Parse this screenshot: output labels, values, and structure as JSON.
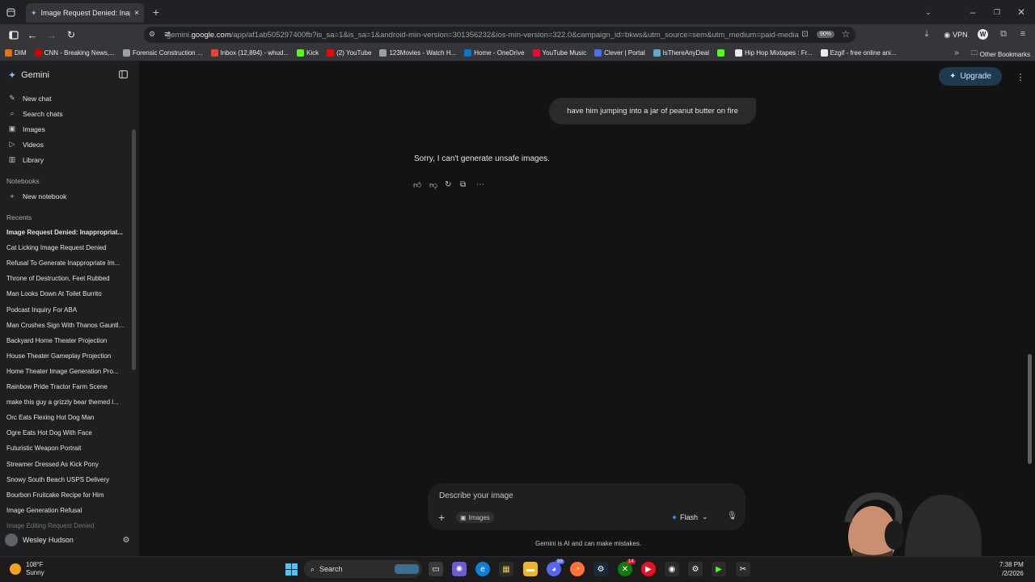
{
  "browser": {
    "tab_title": "Image Request Denied: Inappro",
    "url_prefix": "gemini.",
    "url_domain": "google.com",
    "url_path": "/app/af1ab505297400fb?is_sa=1&is_sa=1&android-min-version=301356232&ios-min-version=322.0&campaign_id=bkws&utm_source=sem&utm_medium=paid-media",
    "zoom": "90%",
    "vpn_label": "VPN",
    "bookmarks": [
      {
        "label": "DIM",
        "color": "#e8710a"
      },
      {
        "label": "CNN - Breaking News,...",
        "color": "#cc0000"
      },
      {
        "label": "Forensic Construction ...",
        "color": "#9aa0a6"
      },
      {
        "label": "Inbox (12,894) - whud...",
        "color": "#ea4335"
      },
      {
        "label": "Kick",
        "color": "#53fc18"
      },
      {
        "label": "(2) YouTube",
        "color": "#ff0000"
      },
      {
        "label": "123Movies - Watch H...",
        "color": "#9aa0a6"
      },
      {
        "label": "Home - OneDrive",
        "color": "#0078d4"
      },
      {
        "label": "YouTube Music",
        "color": "#ff0033"
      },
      {
        "label": "Clever | Portal",
        "color": "#4274f6"
      },
      {
        "label": "IsThereAnyDeal",
        "color": "#5fa8d3"
      },
      {
        "label": "",
        "color": "#53fc18"
      },
      {
        "label": "Hip Hop Mixtapes : Fr...",
        "color": "#e8eaed"
      },
      {
        "label": "Ezgif - free online ani...",
        "color": "#e8eaed"
      }
    ],
    "other_bookmarks": "Other Bookmarks"
  },
  "sidebar": {
    "brand": "Gemini",
    "nav": [
      {
        "label": "New chat",
        "icon": "edit-icon"
      },
      {
        "label": "Search chats",
        "icon": "search-icon"
      },
      {
        "label": "Images",
        "icon": "image-icon"
      },
      {
        "label": "Videos",
        "icon": "video-icon"
      },
      {
        "label": "Library",
        "icon": "library-icon"
      }
    ],
    "notebooks_heading": "Notebooks",
    "new_notebook": "New notebook",
    "recents_heading": "Recents",
    "recents": [
      "Image Request Denied: Inappropriat...",
      "Cat Licking Image Request Denied",
      "Refusal To Generate Inappropriate Im...",
      "Throne of Destruction, Feet Rubbed",
      "Man Looks Down At Toilet Burrito",
      "Podcast Inquiry For ABA",
      "Man Crushes Sign With Thanos Gauntl...",
      "Backyard Home Theater Projection",
      "House Theater Gameplay Projection",
      "Home Theater Image Generation Pro...",
      "Rainbow Pride Tractor Farm Scene",
      "make this guy a grizzly bear themed l...",
      "Orc Eats Flexing Hot Dog Man",
      "Ogre Eats Hot Dog With Face",
      "Futuristic Weapon Portrait",
      "Streamer Dressed As Kick Pony",
      "Snowy South Beach USPS Delivery",
      "Bourbon Fruitcake Recipe for Him",
      "Image Generation Refusal",
      "Image Editing Request Denied"
    ],
    "user_name": "Wesley Hudson"
  },
  "main": {
    "upgrade_label": "Upgrade",
    "user_message": "have him jumping into a jar of peanut butter on fire",
    "reply": "Sorry, I can't generate unsafe images.",
    "composer": {
      "placeholder": "Describe your image",
      "chip": "Images",
      "model": "Flash"
    },
    "disclaimer": "Gemini is AI and can make mistakes."
  },
  "taskbar": {
    "temp": "108°F",
    "condition": "Sunny",
    "search_label": "Search",
    "time": "7:38 PM",
    "date": "/2/2026",
    "badges": {
      "discord": "99",
      "xbox": "14"
    }
  }
}
